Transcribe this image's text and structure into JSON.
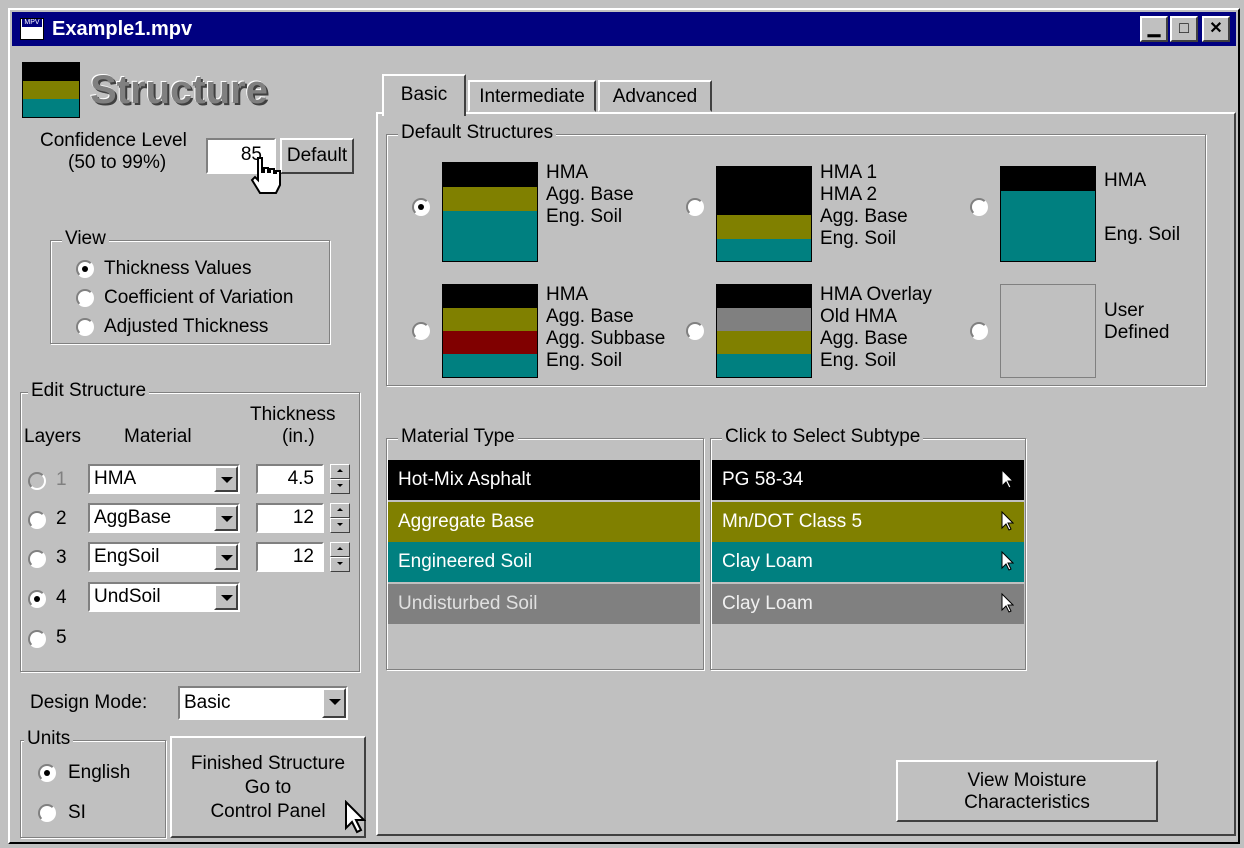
{
  "window": {
    "title": "Example1.mpv",
    "app_icon_text": "MPV",
    "minimize": "▁",
    "maximize": "□",
    "close": "✕"
  },
  "header": {
    "title": "Structure",
    "icon_colors": [
      "#000000",
      "#808000",
      "#008080"
    ]
  },
  "confidence": {
    "label_line1": "Confidence Level",
    "label_line2": "(50 to 99%)",
    "value": "85",
    "default_button": "Default"
  },
  "view": {
    "group_label": "View",
    "options": [
      {
        "label": "Thickness Values",
        "checked": true
      },
      {
        "label": "Coefficient of Variation",
        "checked": false
      },
      {
        "label": "Adjusted Thickness",
        "checked": false
      }
    ]
  },
  "edit_structure": {
    "group_label": "Edit Structure",
    "col_layers": "Layers",
    "col_material": "Material",
    "col_thickness_line1": "Thickness",
    "col_thickness_line2": "(in.)",
    "layers": [
      {
        "num": "1",
        "material": "HMA",
        "thickness": "4.5",
        "checked": false,
        "disabled": true
      },
      {
        "num": "2",
        "material": "AggBase",
        "thickness": "12",
        "checked": false,
        "disabled": false
      },
      {
        "num": "3",
        "material": "EngSoil",
        "thickness": "12",
        "checked": false,
        "disabled": false
      },
      {
        "num": "4",
        "material": "UndSoil",
        "thickness": "",
        "checked": true,
        "disabled": false
      },
      {
        "num": "5",
        "material": "",
        "thickness": "",
        "checked": false,
        "disabled": false
      }
    ]
  },
  "design_mode": {
    "label": "Design Mode:",
    "value": "Basic"
  },
  "units": {
    "group_label": "Units",
    "options": [
      {
        "label": "English",
        "checked": true
      },
      {
        "label": "SI",
        "checked": false
      }
    ]
  },
  "finished_button": {
    "line1": "Finished Structure",
    "line2": "Go to",
    "line3": "Control Panel"
  },
  "tabs": [
    {
      "label": "Basic",
      "active": true
    },
    {
      "label": "Intermediate",
      "active": false
    },
    {
      "label": "Advanced",
      "active": false
    }
  ],
  "default_structures": {
    "group_label": "Default Structures",
    "items": [
      {
        "labels": [
          "HMA",
          "Agg. Base",
          "Eng. Soil"
        ],
        "checked": true
      },
      {
        "labels": [
          "HMA 1",
          "HMA 2",
          "Agg. Base",
          "Eng. Soil"
        ],
        "checked": false
      },
      {
        "labels": [
          "HMA",
          "Eng. Soil"
        ],
        "checked": false
      },
      {
        "labels": [
          "HMA",
          "Agg. Base",
          "Agg. Subbase",
          "Eng. Soil"
        ],
        "checked": false
      },
      {
        "labels": [
          "HMA Overlay",
          "Old HMA",
          "Agg. Base",
          "Eng. Soil"
        ],
        "checked": false
      },
      {
        "labels": [
          "User",
          "Defined"
        ],
        "checked": false
      }
    ]
  },
  "colors": {
    "hma": "#000000",
    "agg_base": "#808000",
    "eng_soil": "#008080",
    "subbase": "#800000",
    "old_hma": "#808080",
    "und_soil": "#808080",
    "title_bar": "#000080",
    "face": "#c0c0c0"
  },
  "material_type": {
    "group_label": "Material Type",
    "rows": [
      "Hot-Mix Asphalt",
      "Aggregate Base",
      "Engineered Soil",
      "Undisturbed Soil"
    ]
  },
  "subtype": {
    "group_label": "Click to Select Subtype",
    "rows": [
      "PG 58-34",
      "Mn/DOT Class 5",
      "Clay Loam",
      "Clay Loam"
    ]
  },
  "moisture_button": {
    "line1": "View Moisture",
    "line2": "Characteristics"
  }
}
